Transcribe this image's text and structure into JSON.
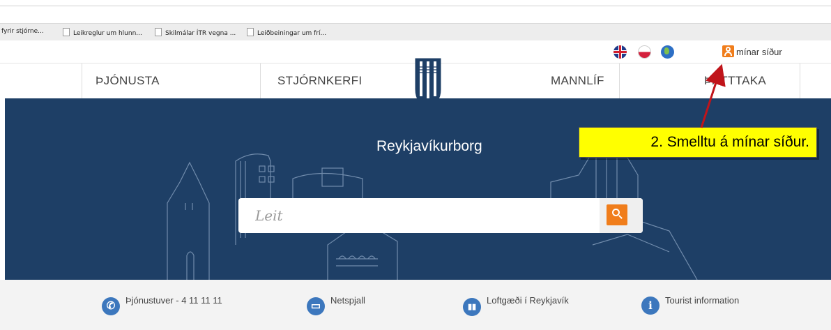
{
  "bookmarks": [
    {
      "label": "fyrir stjórne...",
      "icon": "folder-icon"
    },
    {
      "label": "Leikreglur um hlunn...",
      "icon": "page-icon"
    },
    {
      "label": "Skilmálar ÍTR vegna ...",
      "icon": "page-icon"
    },
    {
      "label": "Leiðbeiningar um frí...",
      "icon": "page-icon"
    }
  ],
  "utility": {
    "my_pages": "mínar síður"
  },
  "nav": {
    "items": [
      "ÞJÓNUSTA",
      "STJÓRNKERFI",
      "MANNLÍF",
      "ÞÁTTTAKA"
    ]
  },
  "hero": {
    "title": "Reykjavíkurborg",
    "search_placeholder": "Leit"
  },
  "footer": {
    "items": [
      "Þjónustuver - 4 11 11 11",
      "Netspjall",
      "Loftgæði í Reykjavík",
      "Tourist information"
    ]
  },
  "callout": {
    "text": "2. Smelltu á mínar síður."
  },
  "colors": {
    "hero_bg": "#1e3f66",
    "accent": "#f07d1b",
    "icon_blue": "#3c77bd",
    "callout_bg": "#ffff00",
    "arrow": "#c0141a"
  }
}
